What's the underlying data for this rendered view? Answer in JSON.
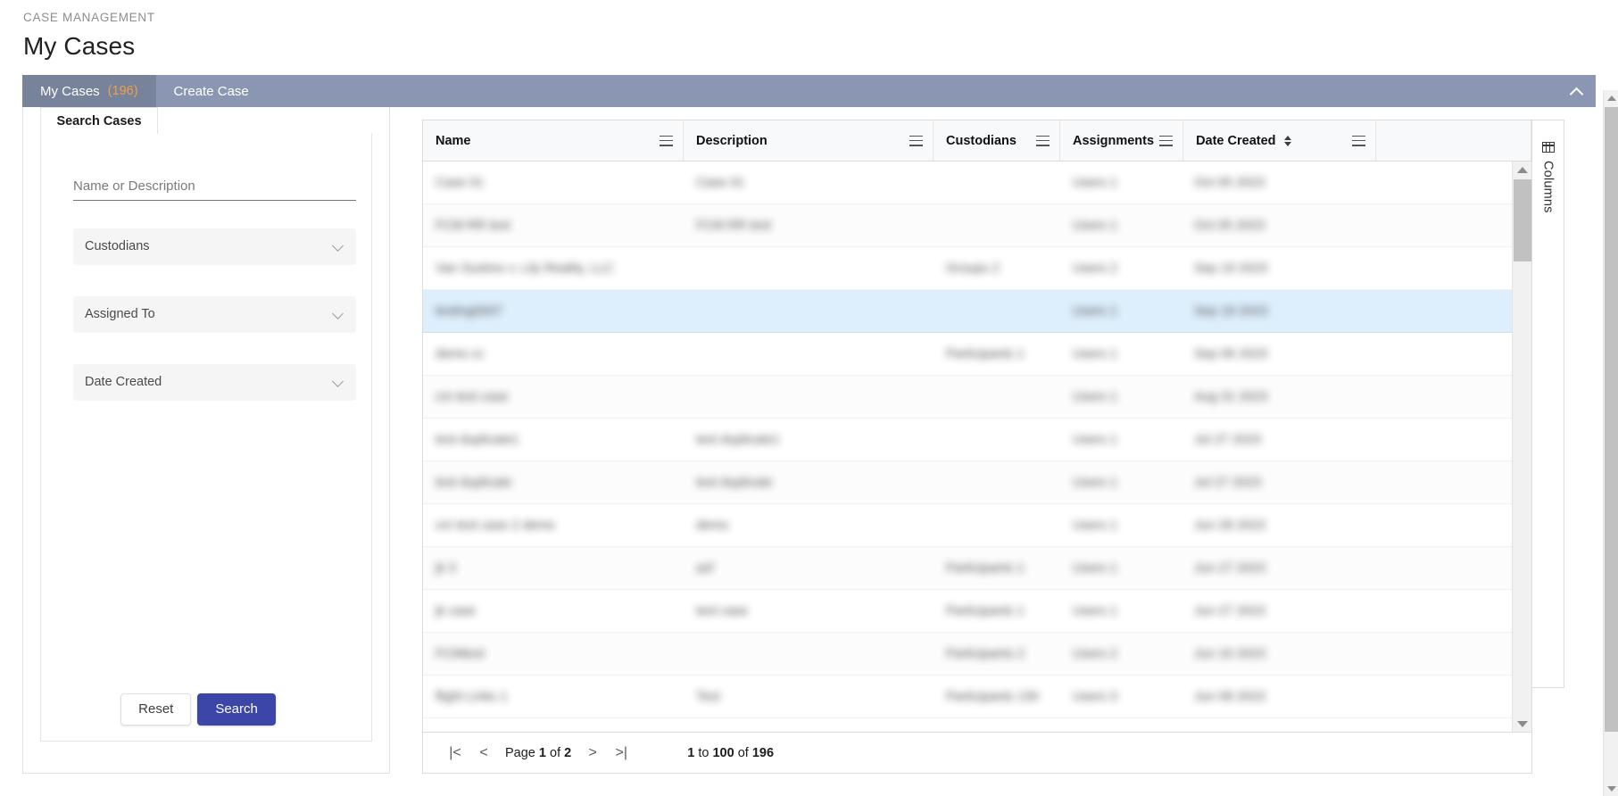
{
  "header": {
    "breadcrumb": "CASE MANAGEMENT",
    "title": "My Cases"
  },
  "tabs": {
    "items": [
      {
        "label": "My Cases",
        "count": "(196)",
        "active": true
      },
      {
        "label": "Create Case",
        "count": "",
        "active": false
      }
    ],
    "collapse_icon": "chevron-up-icon",
    "bar_color": "#8b97b2",
    "active_tab_color": "#77829b",
    "count_color": "#f0a04b"
  },
  "search_panel": {
    "tab_label": "Search Cases",
    "text_field": {
      "value": "",
      "placeholder": "Name or Description"
    },
    "selects": [
      {
        "label": "Custodians",
        "icon": "chevron-down-icon"
      },
      {
        "label": "Assigned To",
        "icon": "chevron-down-icon"
      },
      {
        "label": "Date Created",
        "icon": "chevron-down-icon"
      }
    ],
    "reset_label": "Reset",
    "search_label": "Search",
    "search_button_color": "#3b46a8"
  },
  "grid": {
    "columns": [
      {
        "label": "Name",
        "menu_icon": "hamburger-menu-icon",
        "sort_icon": ""
      },
      {
        "label": "Description",
        "menu_icon": "hamburger-menu-icon",
        "sort_icon": ""
      },
      {
        "label": "Custodians",
        "menu_icon": "hamburger-menu-icon",
        "sort_icon": ""
      },
      {
        "label": "Assignments",
        "menu_icon": "hamburger-menu-icon",
        "sort_icon": ""
      },
      {
        "label": "Date Created",
        "menu_icon": "hamburger-menu-icon",
        "sort_icon": "sort-updown-icon"
      }
    ],
    "rows": [
      {
        "name": "Case 01",
        "description": "Case 01",
        "custodians": "",
        "assignments": "Users 1",
        "date_created": "Oct 05 2023",
        "selected": false
      },
      {
        "name": "FCM RR test",
        "description": "FCM RR test",
        "custodians": "",
        "assignments": "Users 1",
        "date_created": "Oct 05 2023",
        "selected": false
      },
      {
        "name": "Van Sustrex v. Lily Reality, LLC",
        "description": "",
        "custodians": "Groups 2",
        "assignments": "Users 2",
        "date_created": "Sep 19 2023",
        "selected": false
      },
      {
        "name": "testing0007",
        "description": "",
        "custodians": "",
        "assignments": "Users 1",
        "date_created": "Sep 19 2023",
        "selected": true
      },
      {
        "name": "demo cc",
        "description": "",
        "custodians": "Participants 1",
        "assignments": "Users 1",
        "date_created": "Sep 06 2023",
        "selected": false
      },
      {
        "name": "cm test case",
        "description": "",
        "custodians": "",
        "assignments": "Users 1",
        "date_created": "Aug 31 2023",
        "selected": false
      },
      {
        "name": "test duplicate1",
        "description": "test duplicate1",
        "custodians": "",
        "assignments": "Users 1",
        "date_created": "Jul 27 2023",
        "selected": false
      },
      {
        "name": "test duplicate",
        "description": "test duplicate",
        "custodians": "",
        "assignments": "Users 1",
        "date_created": "Jul 27 2023",
        "selected": false
      },
      {
        "name": "cm test case 2 demo",
        "description": "demo",
        "custodians": "",
        "assignments": "Users 1",
        "date_created": "Jun 28 2023",
        "selected": false
      },
      {
        "name": "jk 3",
        "description": "asf",
        "custodians": "Participants 1",
        "assignments": "Users 1",
        "date_created": "Jun 27 2023",
        "selected": false
      },
      {
        "name": "jk case",
        "description": "test case",
        "custodians": "Participants 1",
        "assignments": "Users 1",
        "date_created": "Jun 27 2023",
        "selected": false
      },
      {
        "name": "FCMtest",
        "description": "",
        "custodians": "Participants 2",
        "assignments": "Users 2",
        "date_created": "Jun 16 2023",
        "selected": false
      },
      {
        "name": "flight Links 1",
        "description": "Test",
        "custodians": "Participants 130",
        "assignments": "Users 3",
        "date_created": "Jun 08 2023",
        "selected": false
      }
    ],
    "pagination": {
      "first_icon": "first-page-icon",
      "prev_icon": "prev-page-icon",
      "next_icon": "next-page-icon",
      "last_icon": "last-page-icon",
      "page_prefix": "Page",
      "current_page": "1",
      "page_of": "of",
      "total_pages": "2",
      "range_from": "1",
      "range_to_word": "to",
      "range_to": "100",
      "range_of_word": "of",
      "range_total": "196"
    }
  },
  "columns_tab": {
    "label": "Columns",
    "icon": "columns-table-icon"
  }
}
